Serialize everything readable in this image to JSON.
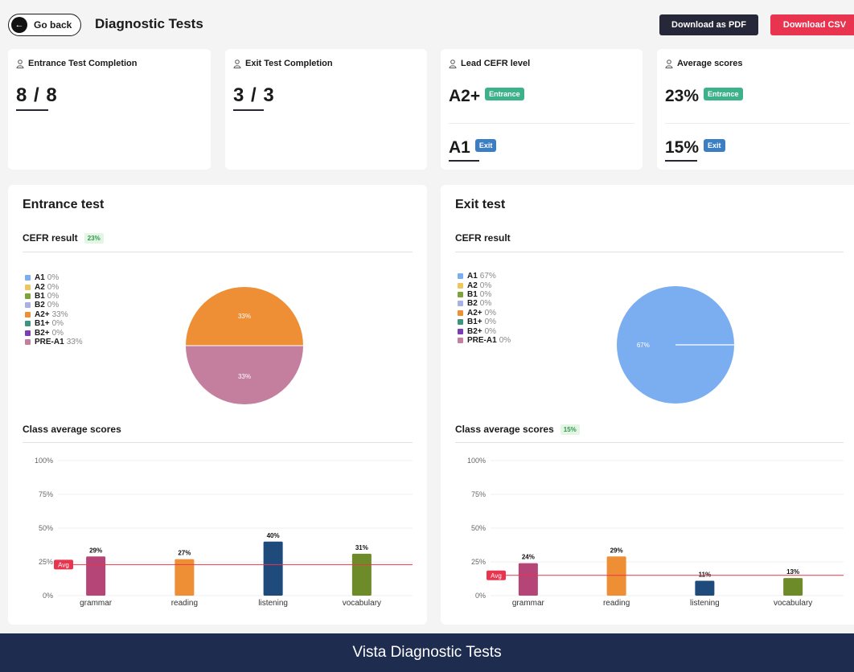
{
  "header": {
    "back_label": "Go back",
    "back_icon": "arrow-left-icon",
    "title": "Diagnostic Tests",
    "pdf_label": "Download as PDF",
    "csv_label": "Download CSV",
    "pdf_color": "#26283a",
    "csv_color": "#e8344e"
  },
  "stats": {
    "entrance_completion": {
      "title": "Entrance Test Completion",
      "value": "8 / 8"
    },
    "exit_completion": {
      "title": "Exit Test Completion",
      "value": "3 / 3"
    },
    "lead_cefr": {
      "title": "Lead CEFR level",
      "entrance_value": "A2+",
      "exit_value": "A1",
      "entrance_tag": "Entrance",
      "exit_tag": "Exit"
    },
    "average_scores": {
      "title": "Average scores",
      "entrance_value": "23%",
      "exit_value": "15%",
      "entrance_tag": "Entrance",
      "exit_tag": "Exit"
    }
  },
  "entrance": {
    "title": "Entrance test",
    "cefr_title": "CEFR result",
    "cefr_badge": "23%",
    "legend": [
      {
        "name": "A1",
        "value": "0%",
        "color": "#7baef0"
      },
      {
        "name": "A2",
        "value": "0%",
        "color": "#ecc75c"
      },
      {
        "name": "B1",
        "value": "0%",
        "color": "#7ea33a"
      },
      {
        "name": "B2",
        "value": "0%",
        "color": "#a9b0e4"
      },
      {
        "name": "A2+",
        "value": "33%",
        "color": "#ee8f35"
      },
      {
        "name": "B1+",
        "value": "0%",
        "color": "#3c9481"
      },
      {
        "name": "B2+",
        "value": "0%",
        "color": "#7b3db5"
      },
      {
        "name": "PRE-A1",
        "value": "33%",
        "color": "#c47e9e"
      }
    ],
    "scores_title": "Class average scores"
  },
  "exit": {
    "title": "Exit test",
    "cefr_title": "CEFR result",
    "legend": [
      {
        "name": "A1",
        "value": "67%",
        "color": "#7baef0"
      },
      {
        "name": "A2",
        "value": "0%",
        "color": "#ecc75c"
      },
      {
        "name": "B1",
        "value": "0%",
        "color": "#7ea33a"
      },
      {
        "name": "B2",
        "value": "0%",
        "color": "#a9b0e4"
      },
      {
        "name": "A2+",
        "value": "0%",
        "color": "#ee8f35"
      },
      {
        "name": "B1+",
        "value": "0%",
        "color": "#3c9481"
      },
      {
        "name": "B2+",
        "value": "0%",
        "color": "#7b3db5"
      },
      {
        "name": "PRE-A1",
        "value": "0%",
        "color": "#c47e9e"
      }
    ],
    "scores_title": "Class average scores",
    "scores_badge": "15%"
  },
  "footer": {
    "text": "Vista Diagnostic Tests"
  },
  "chart_data": [
    {
      "type": "pie",
      "labels": [
        "A2+",
        "PRE-A1"
      ],
      "values": [
        33,
        33
      ],
      "value_labels": [
        "33%",
        "33%"
      ],
      "colors": [
        "#ee8f35",
        "#c47e9e"
      ]
    },
    {
      "type": "pie",
      "labels": [
        "A1"
      ],
      "values": [
        67
      ],
      "value_labels": [
        "67%"
      ],
      "colors": [
        "#7baef0"
      ]
    },
    {
      "type": "bar",
      "categories": [
        "grammar",
        "reading",
        "listening",
        "vocabulary"
      ],
      "values": [
        29,
        27,
        40,
        31
      ],
      "value_labels": [
        "29%",
        "27%",
        "40%",
        "31%"
      ],
      "colors": [
        "#b54577",
        "#ee8f35",
        "#1f4a7c",
        "#6e8b2a"
      ],
      "yticks": [
        "0%",
        "25%",
        "50%",
        "75%",
        "100%"
      ],
      "ylim": [
        0,
        100
      ],
      "avg": 23,
      "avg_label": "Avg",
      "grid": true
    },
    {
      "type": "bar",
      "categories": [
        "grammar",
        "reading",
        "listening",
        "vocabulary"
      ],
      "values": [
        24,
        29,
        11,
        13
      ],
      "value_labels": [
        "24%",
        "29%",
        "11%",
        "13%"
      ],
      "colors": [
        "#b54577",
        "#ee8f35",
        "#1f4a7c",
        "#6e8b2a"
      ],
      "yticks": [
        "0%",
        "25%",
        "50%",
        "75%",
        "100%"
      ],
      "ylim": [
        0,
        100
      ],
      "avg": 15,
      "avg_label": "Avg",
      "grid": true
    }
  ]
}
